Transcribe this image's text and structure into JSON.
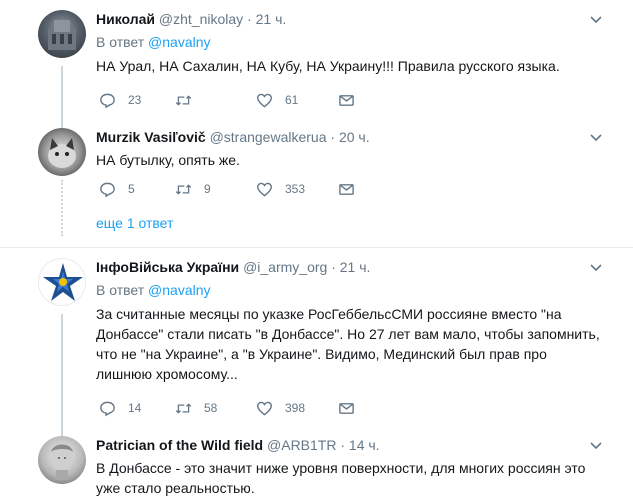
{
  "tweets": [
    {
      "name": "Николай",
      "handle": "@zht_nikolay",
      "time": "21 ч.",
      "reply_label": "В ответ",
      "reply_to": "@navalny",
      "text": "НА Урал, НА Сахалин, НА Кубу, НА Украину!!! Правила русского языка.",
      "replies": "23",
      "retweets": "",
      "likes": "61"
    },
    {
      "name": "Murzik Vasiľovič",
      "handle": "@strangewalkerua",
      "time": "20 ч.",
      "text": "НА бутылку, опять же.",
      "replies": "5",
      "retweets": "9",
      "likes": "353"
    },
    {
      "name": "ІнфоВійська України",
      "handle": "@i_army_org",
      "time": "21 ч.",
      "reply_label": "В ответ",
      "reply_to": "@navalny",
      "text": "За считанные месяцы по указке РосГеббельсСМИ россияне вместо \"на\nДонбассе\" стали писать \"в Донбассе\". Но 27 лет вам мало, чтобы запомнить,\nчто не \"на Украине\", а \"в Украине\". Видимо, Мединский был прав про\nлишнюю хромосому...",
      "replies": "14",
      "retweets": "58",
      "likes": "398"
    },
    {
      "name": "Patrician of the Wild field",
      "handle": "@ARB1TR",
      "time": "14 ч.",
      "text": "В Донбассе - это значит ниже уровня  поверхности, для многих россиян это\nуже стало реальностью."
    }
  ],
  "more_replies": "еще 1 ответ",
  "dot": "·",
  "colors": {
    "accent": "#1da1f2",
    "muted": "#657786",
    "border": "#e6ecf0"
  }
}
